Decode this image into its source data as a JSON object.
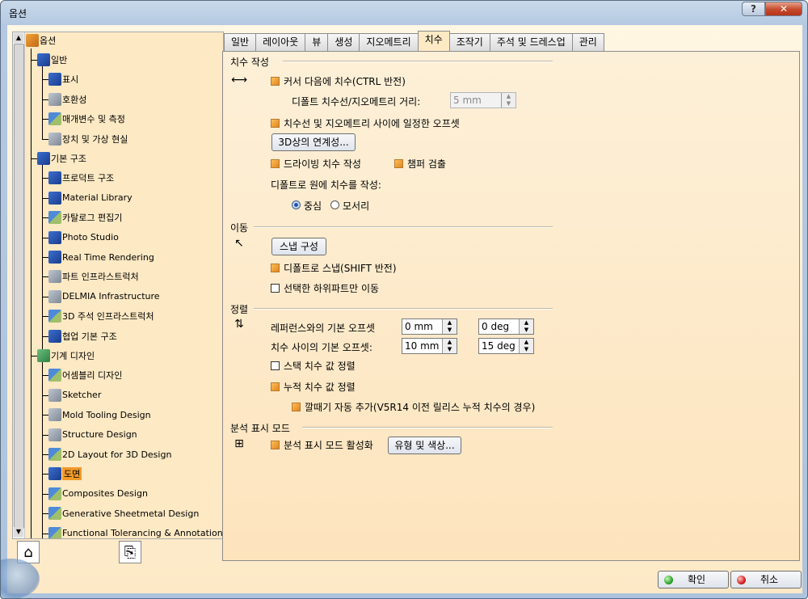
{
  "window": {
    "title": "옵션",
    "help_label": "?",
    "close_label": "✕"
  },
  "tree": {
    "scroll_up": "▲",
    "scroll_down": "▼",
    "root": {
      "label": "옵션",
      "icon": "options-root-icon"
    },
    "items": [
      {
        "label": "일반",
        "icon": "general-icon"
      },
      {
        "label": "표시",
        "icon": "display-icon"
      },
      {
        "label": "호환성",
        "icon": "compatibility-icon"
      },
      {
        "label": "매개변수 및 측정",
        "icon": "parameters-icon"
      },
      {
        "label": "장치 및 가상 현실",
        "icon": "devices-vr-icon"
      },
      {
        "label": "기본 구조",
        "icon": "infrastructure-icon"
      },
      {
        "label": "프로덕트 구조",
        "icon": "product-structure-icon"
      },
      {
        "label": "Material Library",
        "icon": "material-library-icon"
      },
      {
        "label": "카탈로그 편집기",
        "icon": "catalog-editor-icon"
      },
      {
        "label": "Photo Studio",
        "icon": "photo-studio-icon"
      },
      {
        "label": "Real Time Rendering",
        "icon": "real-time-rendering-icon"
      },
      {
        "label": "파트 인프라스트럭처",
        "icon": "part-infrastructure-icon"
      },
      {
        "label": "DELMIA Infrastructure",
        "icon": "delmia-infrastructure-icon"
      },
      {
        "label": "3D 주석 인프라스트럭처",
        "icon": "3d-annotation-icon"
      },
      {
        "label": "협업 기본 구조",
        "icon": "collaboration-icon"
      },
      {
        "label": "기계 디자인",
        "icon": "mechanical-design-icon"
      },
      {
        "label": "어셈블리 디자인",
        "icon": "assembly-design-icon"
      },
      {
        "label": "Sketcher",
        "icon": "sketcher-icon"
      },
      {
        "label": "Mold Tooling Design",
        "icon": "mold-tooling-icon"
      },
      {
        "label": "Structure Design",
        "icon": "structure-design-icon"
      },
      {
        "label": "2D Layout for 3D Design",
        "icon": "2d-layout-icon"
      },
      {
        "label": "도면",
        "icon": "drafting-icon",
        "selected": true
      },
      {
        "label": "Composites Design",
        "icon": "composites-icon"
      },
      {
        "label": "Generative Sheetmetal Design",
        "icon": "sheetmetal-icon"
      },
      {
        "label": "Functional Tolerancing & Annotation",
        "icon": "tolerancing-icon"
      }
    ]
  },
  "tabs": [
    "일반",
    "레이아웃",
    "뷰",
    "생성",
    "지오메트리",
    "치수",
    "조작기",
    "주석 및 드레스업",
    "관리"
  ],
  "active_tab": "치수",
  "sections": {
    "dimension_creation": {
      "title": "치수 작성",
      "follow_cursor": "커서 다음에 치수(CTRL 반전)",
      "default_distance_label": "디폴트 치수선/지오메트리 거리:",
      "default_distance_value": "5 mm",
      "constant_offset": "치수선 및 지오메트리 사이에 일정한 오프셋",
      "associativity_button": "3D상의 연계성...",
      "driving_dimensions": "드라이빙 치수 작성",
      "chamfer_detection": "챔퍼 검출",
      "circle_default_label": "디폴트로 원에 치수를 작성:",
      "center_label": "중심",
      "edge_label": "모서리"
    },
    "move": {
      "title": "이동",
      "snap_button": "스냅 구성",
      "default_snap": "디폴트로 스냅(SHIFT 반전)",
      "move_subpart": "선택한 하위파트만 이동"
    },
    "alignment": {
      "title": "정렬",
      "ref_offset_label": "레퍼런스와의 기본 오프셋",
      "ref_offset_mm": "0 mm",
      "ref_offset_deg": "0 deg",
      "between_offset_label": "치수 사이의 기본 오프셋:",
      "between_offset_mm": "10 mm",
      "between_offset_deg": "15 deg",
      "stack_align": "스택 치수 값 정렬",
      "cumulate_align": "누적 치수 값 정렬",
      "funnel_auto": "깔때기 자동 추가(V5R14 이전 릴리스 누적 치수의 경우)"
    },
    "analysis": {
      "title": "분석 표시 모드",
      "enable": "분석 표시 모드 활성화",
      "types_button": "유형 및 색상..."
    }
  },
  "footer": {
    "ok": "확인",
    "cancel": "취소"
  },
  "colors": {
    "selected_bg": "#f09a28",
    "checkbox_on": "#f0a030",
    "panel_bg": "#fde9c4"
  }
}
